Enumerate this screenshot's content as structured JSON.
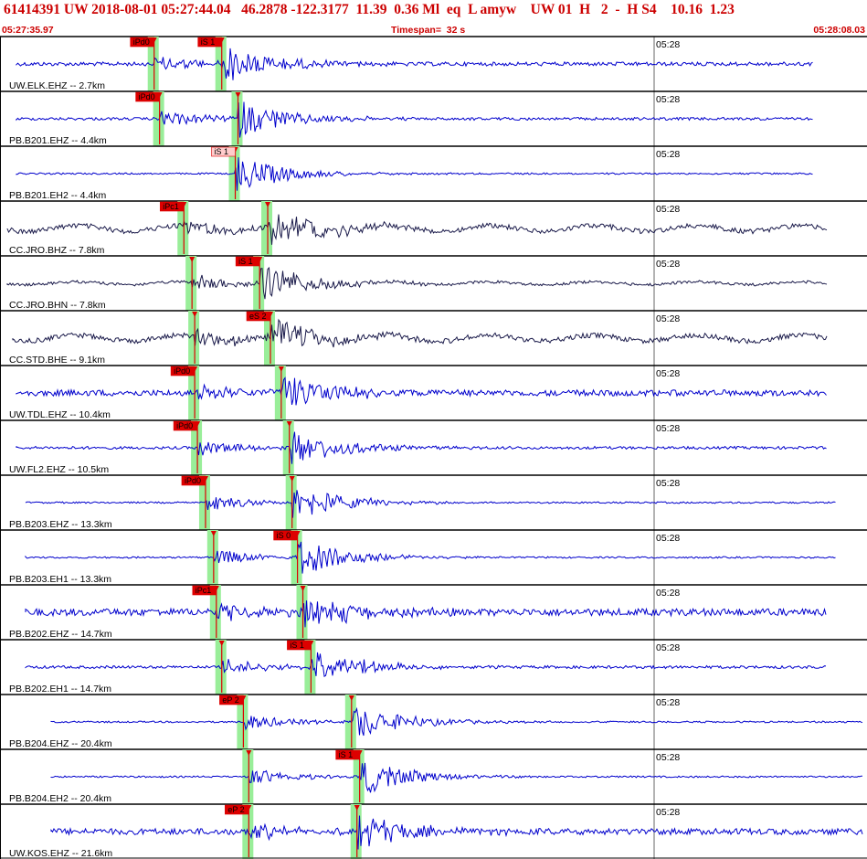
{
  "header": {
    "title": "61414391 UW 2018-08-01 05:27:44.04   46.2878 -122.3177  11.39  0.36 Ml  eq  L amyw    UW 01  H   2  -  H S4    10.16  1.23",
    "start_time": "05:27:35.97",
    "timespan": "Timespan=  32 s",
    "end_time": "05:28:08.03"
  },
  "colors": {
    "header_text": "#cc0000",
    "trace_blue": "#0000cc",
    "trace_dark": "#1a1a4a",
    "pick_box": "#dd0000",
    "pick_box_pale": "#ffcccc",
    "pick_line": "#dd0000",
    "green_band": "#99ee99",
    "separator": "#000000"
  },
  "minute_marker": "05:28",
  "panels": [
    {
      "label": "UW.ELK.EHZ -- 2.7km",
      "color": "trace_blue",
      "amp": 3,
      "picks": [
        {
          "label": "iPd0",
          "t": 5.7
        },
        {
          "label": "iS 1",
          "t": 8.2
        }
      ]
    },
    {
      "label": "PB.B201.EHZ -- 4.4km",
      "color": "trace_blue",
      "amp": 2,
      "picks": [
        {
          "label": "iPd0",
          "t": 5.9
        },
        {
          "label": "",
          "t": 8.8
        }
      ]
    },
    {
      "label": "PB.B201.EH2 -- 4.4km",
      "color": "trace_blue",
      "amp": 1,
      "picks": [
        {
          "label": "iS 1",
          "t": 8.7,
          "pale": true
        }
      ]
    },
    {
      "label": "CC.JRO.BHZ -- 7.8km",
      "color": "trace_dark",
      "amp": 4,
      "picks": [
        {
          "label": "iPc1",
          "t": 6.8
        },
        {
          "label": "",
          "t": 9.9
        }
      ]
    },
    {
      "label": "CC.JRO.BHN -- 7.8km",
      "color": "trace_dark",
      "amp": 2,
      "picks": [
        {
          "label": "",
          "t": 7.1
        },
        {
          "label": "iS 1",
          "t": 9.6
        }
      ]
    },
    {
      "label": "CC.STD.BHE -- 9.1km",
      "color": "trace_dark",
      "amp": 4,
      "picks": [
        {
          "label": "",
          "t": 7.2
        },
        {
          "label": "eS 2",
          "t": 10.0
        }
      ]
    },
    {
      "label": "UW.TDL.EHZ -- 10.4km",
      "color": "trace_blue",
      "amp": 5,
      "picks": [
        {
          "label": "iPd0",
          "t": 7.2
        },
        {
          "label": "",
          "t": 10.4
        }
      ]
    },
    {
      "label": "UW.FL2.EHZ -- 10.5km",
      "color": "trace_blue",
      "amp": 2,
      "picks": [
        {
          "label": "iPd0",
          "t": 7.3
        },
        {
          "label": "",
          "t": 10.7
        }
      ]
    },
    {
      "label": "PB.B203.EHZ -- 13.3km",
      "color": "trace_blue",
      "amp": 1,
      "picks": [
        {
          "label": "iPd0",
          "t": 7.6
        },
        {
          "label": "",
          "t": 10.8
        }
      ]
    },
    {
      "label": "PB.B203.EH1 -- 13.3km",
      "color": "trace_blue",
      "amp": 1,
      "picks": [
        {
          "label": "",
          "t": 7.9
        },
        {
          "label": "iS 0",
          "t": 11.0
        }
      ]
    },
    {
      "label": "PB.B202.EHZ -- 14.7km",
      "color": "trace_blue",
      "amp": 6,
      "picks": [
        {
          "label": "iPc1",
          "t": 8.0
        },
        {
          "label": "",
          "t": 11.2
        }
      ]
    },
    {
      "label": "PB.B202.EH1 -- 14.7km",
      "color": "trace_blue",
      "amp": 2,
      "picks": [
        {
          "label": "",
          "t": 8.2
        },
        {
          "label": "iS 1",
          "t": 11.5
        }
      ]
    },
    {
      "label": "PB.B204.EHZ -- 20.4km",
      "color": "trace_blue",
      "amp": 1,
      "picks": [
        {
          "label": "eP 2",
          "t": 9.0
        },
        {
          "label": "",
          "t": 13.0
        }
      ]
    },
    {
      "label": "PB.B204.EH2 -- 20.4km",
      "color": "trace_blue",
      "amp": 1,
      "picks": [
        {
          "label": "",
          "t": 9.2
        },
        {
          "label": "iS 1",
          "t": 13.3
        }
      ]
    },
    {
      "label": "UW.KOS.EHZ -- 21.6km",
      "color": "trace_blue",
      "amp": 5,
      "picks": [
        {
          "label": "eP 2",
          "t": 9.2
        },
        {
          "label": "",
          "t": 13.2
        }
      ]
    }
  ]
}
